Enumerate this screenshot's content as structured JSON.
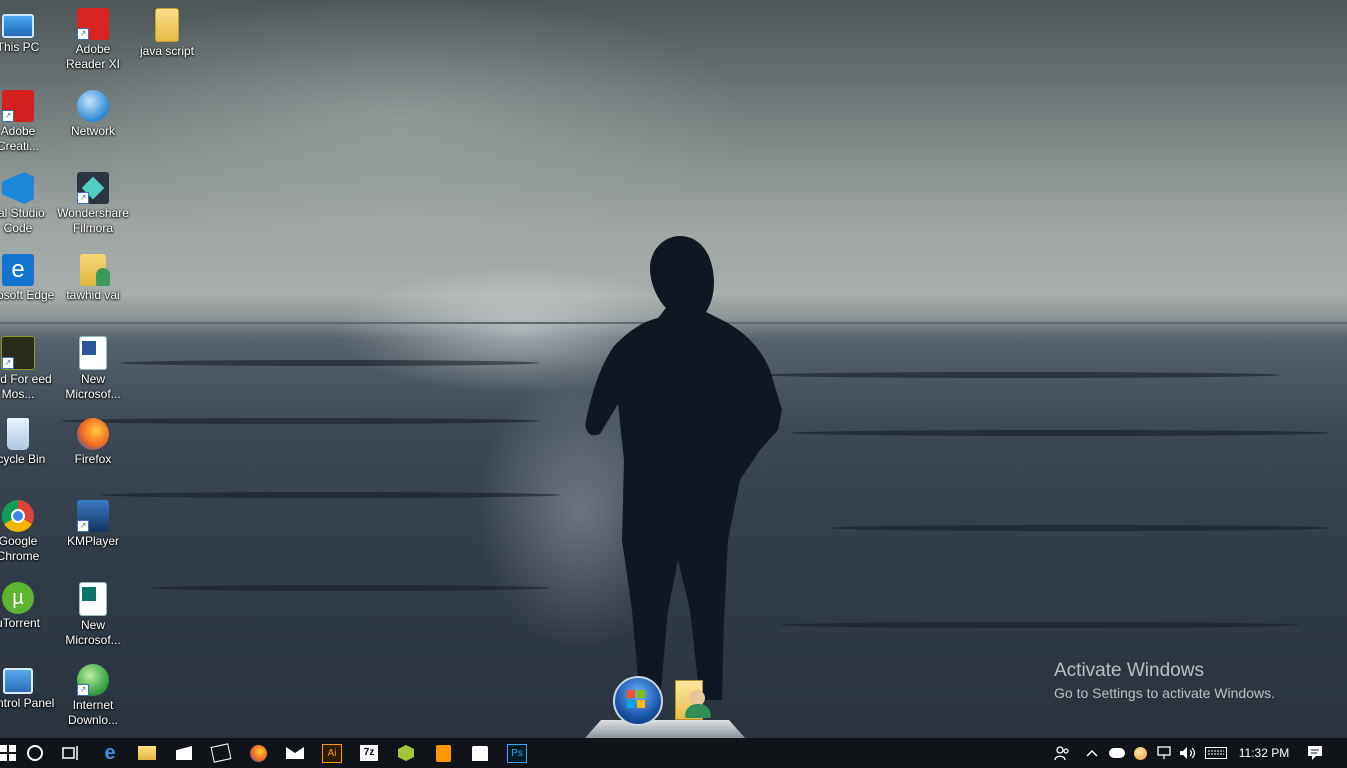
{
  "desktop_icons": [
    {
      "label": "This PC",
      "icon": "this-pc-icon"
    },
    {
      "label": "Adobe Reader XI",
      "icon": "adobe-reader-icon"
    },
    {
      "label": "java script",
      "icon": "folder-icon"
    },
    {
      "label": "Adobe Creati...",
      "icon": "adobe-creative-cloud-icon"
    },
    {
      "label": "Network",
      "icon": "network-icon"
    },
    {
      "label": "ual Studio Code",
      "icon": "vscode-icon"
    },
    {
      "label": "Wondershare Filmora",
      "icon": "filmora-icon"
    },
    {
      "label": "licrosoft Edge",
      "icon": "edge-icon"
    },
    {
      "label": "tawhid vai",
      "icon": "user-folder-icon"
    },
    {
      "label": "leed For eed Mos...",
      "icon": "nfs-icon"
    },
    {
      "label": "New Microsof...",
      "icon": "word-doc-icon"
    },
    {
      "label": "ecycle Bin",
      "icon": "recycle-bin-icon"
    },
    {
      "label": "Firefox",
      "icon": "firefox-icon"
    },
    {
      "label": "Google Chrome",
      "icon": "chrome-icon"
    },
    {
      "label": "KMPlayer",
      "icon": "kmplayer-icon"
    },
    {
      "label": "uTorrent",
      "icon": "utorrent-icon"
    },
    {
      "label": "New Microsof...",
      "icon": "publisher-doc-icon"
    },
    {
      "label": "Control Panel",
      "icon": "control-panel-icon"
    },
    {
      "label": "Internet Downlo...",
      "icon": "idm-icon"
    }
  ],
  "watermark": {
    "title": "Activate Windows",
    "subtitle": "Go to Settings to activate Windows."
  },
  "dock": {
    "items": [
      "windows-orb-icon",
      "user-folder-icon"
    ]
  },
  "taskbar": {
    "pinned": [
      "start-icon",
      "search-circle-icon",
      "task-view-icon",
      "edge-icon",
      "file-explorer-icon",
      "movies-icon",
      "solitaire-icon",
      "firefox-icon",
      "mail-icon",
      "illustrator-icon",
      "7zip-icon",
      "android-studio-icon",
      "sublime-icon",
      "store-icon",
      "photoshop-icon"
    ],
    "illustrator_label": "Ai",
    "sevenzip_label": "7z",
    "photoshop_label": "Ps",
    "clock": "11:32 PM"
  },
  "colors": {
    "taskbar": "#101418",
    "accent": "#0078d7"
  }
}
